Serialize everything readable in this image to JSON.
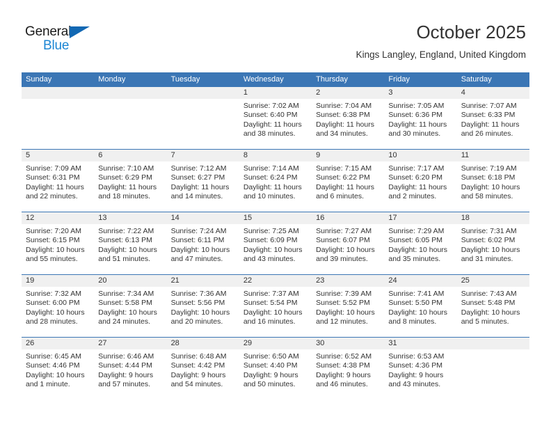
{
  "brand": {
    "line1": "General",
    "line2": "Blue",
    "triangle_icon": "brand-triangle-icon",
    "colors": {
      "blue": "#1c86d4",
      "triangle": "#1268b3",
      "dark": "#1a1a1a"
    }
  },
  "header": {
    "title": "October 2025",
    "subtitle": "Kings Langley, England, United Kingdom"
  },
  "calendar": {
    "header_bg": "#3b76b5",
    "daynum_bg": "#f0f0f0",
    "weekdays": [
      "Sunday",
      "Monday",
      "Tuesday",
      "Wednesday",
      "Thursday",
      "Friday",
      "Saturday"
    ],
    "weeks": [
      [
        {
          "day": "",
          "empty": true
        },
        {
          "day": "",
          "empty": true
        },
        {
          "day": "",
          "empty": true
        },
        {
          "day": "1",
          "sunrise": "Sunrise: 7:02 AM",
          "sunset": "Sunset: 6:40 PM",
          "daylight": "Daylight: 11 hours and 38 minutes."
        },
        {
          "day": "2",
          "sunrise": "Sunrise: 7:04 AM",
          "sunset": "Sunset: 6:38 PM",
          "daylight": "Daylight: 11 hours and 34 minutes."
        },
        {
          "day": "3",
          "sunrise": "Sunrise: 7:05 AM",
          "sunset": "Sunset: 6:36 PM",
          "daylight": "Daylight: 11 hours and 30 minutes."
        },
        {
          "day": "4",
          "sunrise": "Sunrise: 7:07 AM",
          "sunset": "Sunset: 6:33 PM",
          "daylight": "Daylight: 11 hours and 26 minutes."
        }
      ],
      [
        {
          "day": "5",
          "sunrise": "Sunrise: 7:09 AM",
          "sunset": "Sunset: 6:31 PM",
          "daylight": "Daylight: 11 hours and 22 minutes."
        },
        {
          "day": "6",
          "sunrise": "Sunrise: 7:10 AM",
          "sunset": "Sunset: 6:29 PM",
          "daylight": "Daylight: 11 hours and 18 minutes."
        },
        {
          "day": "7",
          "sunrise": "Sunrise: 7:12 AM",
          "sunset": "Sunset: 6:27 PM",
          "daylight": "Daylight: 11 hours and 14 minutes."
        },
        {
          "day": "8",
          "sunrise": "Sunrise: 7:14 AM",
          "sunset": "Sunset: 6:24 PM",
          "daylight": "Daylight: 11 hours and 10 minutes."
        },
        {
          "day": "9",
          "sunrise": "Sunrise: 7:15 AM",
          "sunset": "Sunset: 6:22 PM",
          "daylight": "Daylight: 11 hours and 6 minutes."
        },
        {
          "day": "10",
          "sunrise": "Sunrise: 7:17 AM",
          "sunset": "Sunset: 6:20 PM",
          "daylight": "Daylight: 11 hours and 2 minutes."
        },
        {
          "day": "11",
          "sunrise": "Sunrise: 7:19 AM",
          "sunset": "Sunset: 6:18 PM",
          "daylight": "Daylight: 10 hours and 58 minutes."
        }
      ],
      [
        {
          "day": "12",
          "sunrise": "Sunrise: 7:20 AM",
          "sunset": "Sunset: 6:15 PM",
          "daylight": "Daylight: 10 hours and 55 minutes."
        },
        {
          "day": "13",
          "sunrise": "Sunrise: 7:22 AM",
          "sunset": "Sunset: 6:13 PM",
          "daylight": "Daylight: 10 hours and 51 minutes."
        },
        {
          "day": "14",
          "sunrise": "Sunrise: 7:24 AM",
          "sunset": "Sunset: 6:11 PM",
          "daylight": "Daylight: 10 hours and 47 minutes."
        },
        {
          "day": "15",
          "sunrise": "Sunrise: 7:25 AM",
          "sunset": "Sunset: 6:09 PM",
          "daylight": "Daylight: 10 hours and 43 minutes."
        },
        {
          "day": "16",
          "sunrise": "Sunrise: 7:27 AM",
          "sunset": "Sunset: 6:07 PM",
          "daylight": "Daylight: 10 hours and 39 minutes."
        },
        {
          "day": "17",
          "sunrise": "Sunrise: 7:29 AM",
          "sunset": "Sunset: 6:05 PM",
          "daylight": "Daylight: 10 hours and 35 minutes."
        },
        {
          "day": "18",
          "sunrise": "Sunrise: 7:31 AM",
          "sunset": "Sunset: 6:02 PM",
          "daylight": "Daylight: 10 hours and 31 minutes."
        }
      ],
      [
        {
          "day": "19",
          "sunrise": "Sunrise: 7:32 AM",
          "sunset": "Sunset: 6:00 PM",
          "daylight": "Daylight: 10 hours and 28 minutes."
        },
        {
          "day": "20",
          "sunrise": "Sunrise: 7:34 AM",
          "sunset": "Sunset: 5:58 PM",
          "daylight": "Daylight: 10 hours and 24 minutes."
        },
        {
          "day": "21",
          "sunrise": "Sunrise: 7:36 AM",
          "sunset": "Sunset: 5:56 PM",
          "daylight": "Daylight: 10 hours and 20 minutes."
        },
        {
          "day": "22",
          "sunrise": "Sunrise: 7:37 AM",
          "sunset": "Sunset: 5:54 PM",
          "daylight": "Daylight: 10 hours and 16 minutes."
        },
        {
          "day": "23",
          "sunrise": "Sunrise: 7:39 AM",
          "sunset": "Sunset: 5:52 PM",
          "daylight": "Daylight: 10 hours and 12 minutes."
        },
        {
          "day": "24",
          "sunrise": "Sunrise: 7:41 AM",
          "sunset": "Sunset: 5:50 PM",
          "daylight": "Daylight: 10 hours and 8 minutes."
        },
        {
          "day": "25",
          "sunrise": "Sunrise: 7:43 AM",
          "sunset": "Sunset: 5:48 PM",
          "daylight": "Daylight: 10 hours and 5 minutes."
        }
      ],
      [
        {
          "day": "26",
          "sunrise": "Sunrise: 6:45 AM",
          "sunset": "Sunset: 4:46 PM",
          "daylight": "Daylight: 10 hours and 1 minute."
        },
        {
          "day": "27",
          "sunrise": "Sunrise: 6:46 AM",
          "sunset": "Sunset: 4:44 PM",
          "daylight": "Daylight: 9 hours and 57 minutes."
        },
        {
          "day": "28",
          "sunrise": "Sunrise: 6:48 AM",
          "sunset": "Sunset: 4:42 PM",
          "daylight": "Daylight: 9 hours and 54 minutes."
        },
        {
          "day": "29",
          "sunrise": "Sunrise: 6:50 AM",
          "sunset": "Sunset: 4:40 PM",
          "daylight": "Daylight: 9 hours and 50 minutes."
        },
        {
          "day": "30",
          "sunrise": "Sunrise: 6:52 AM",
          "sunset": "Sunset: 4:38 PM",
          "daylight": "Daylight: 9 hours and 46 minutes."
        },
        {
          "day": "31",
          "sunrise": "Sunrise: 6:53 AM",
          "sunset": "Sunset: 4:36 PM",
          "daylight": "Daylight: 9 hours and 43 minutes."
        },
        {
          "day": "",
          "empty": true
        }
      ]
    ]
  }
}
